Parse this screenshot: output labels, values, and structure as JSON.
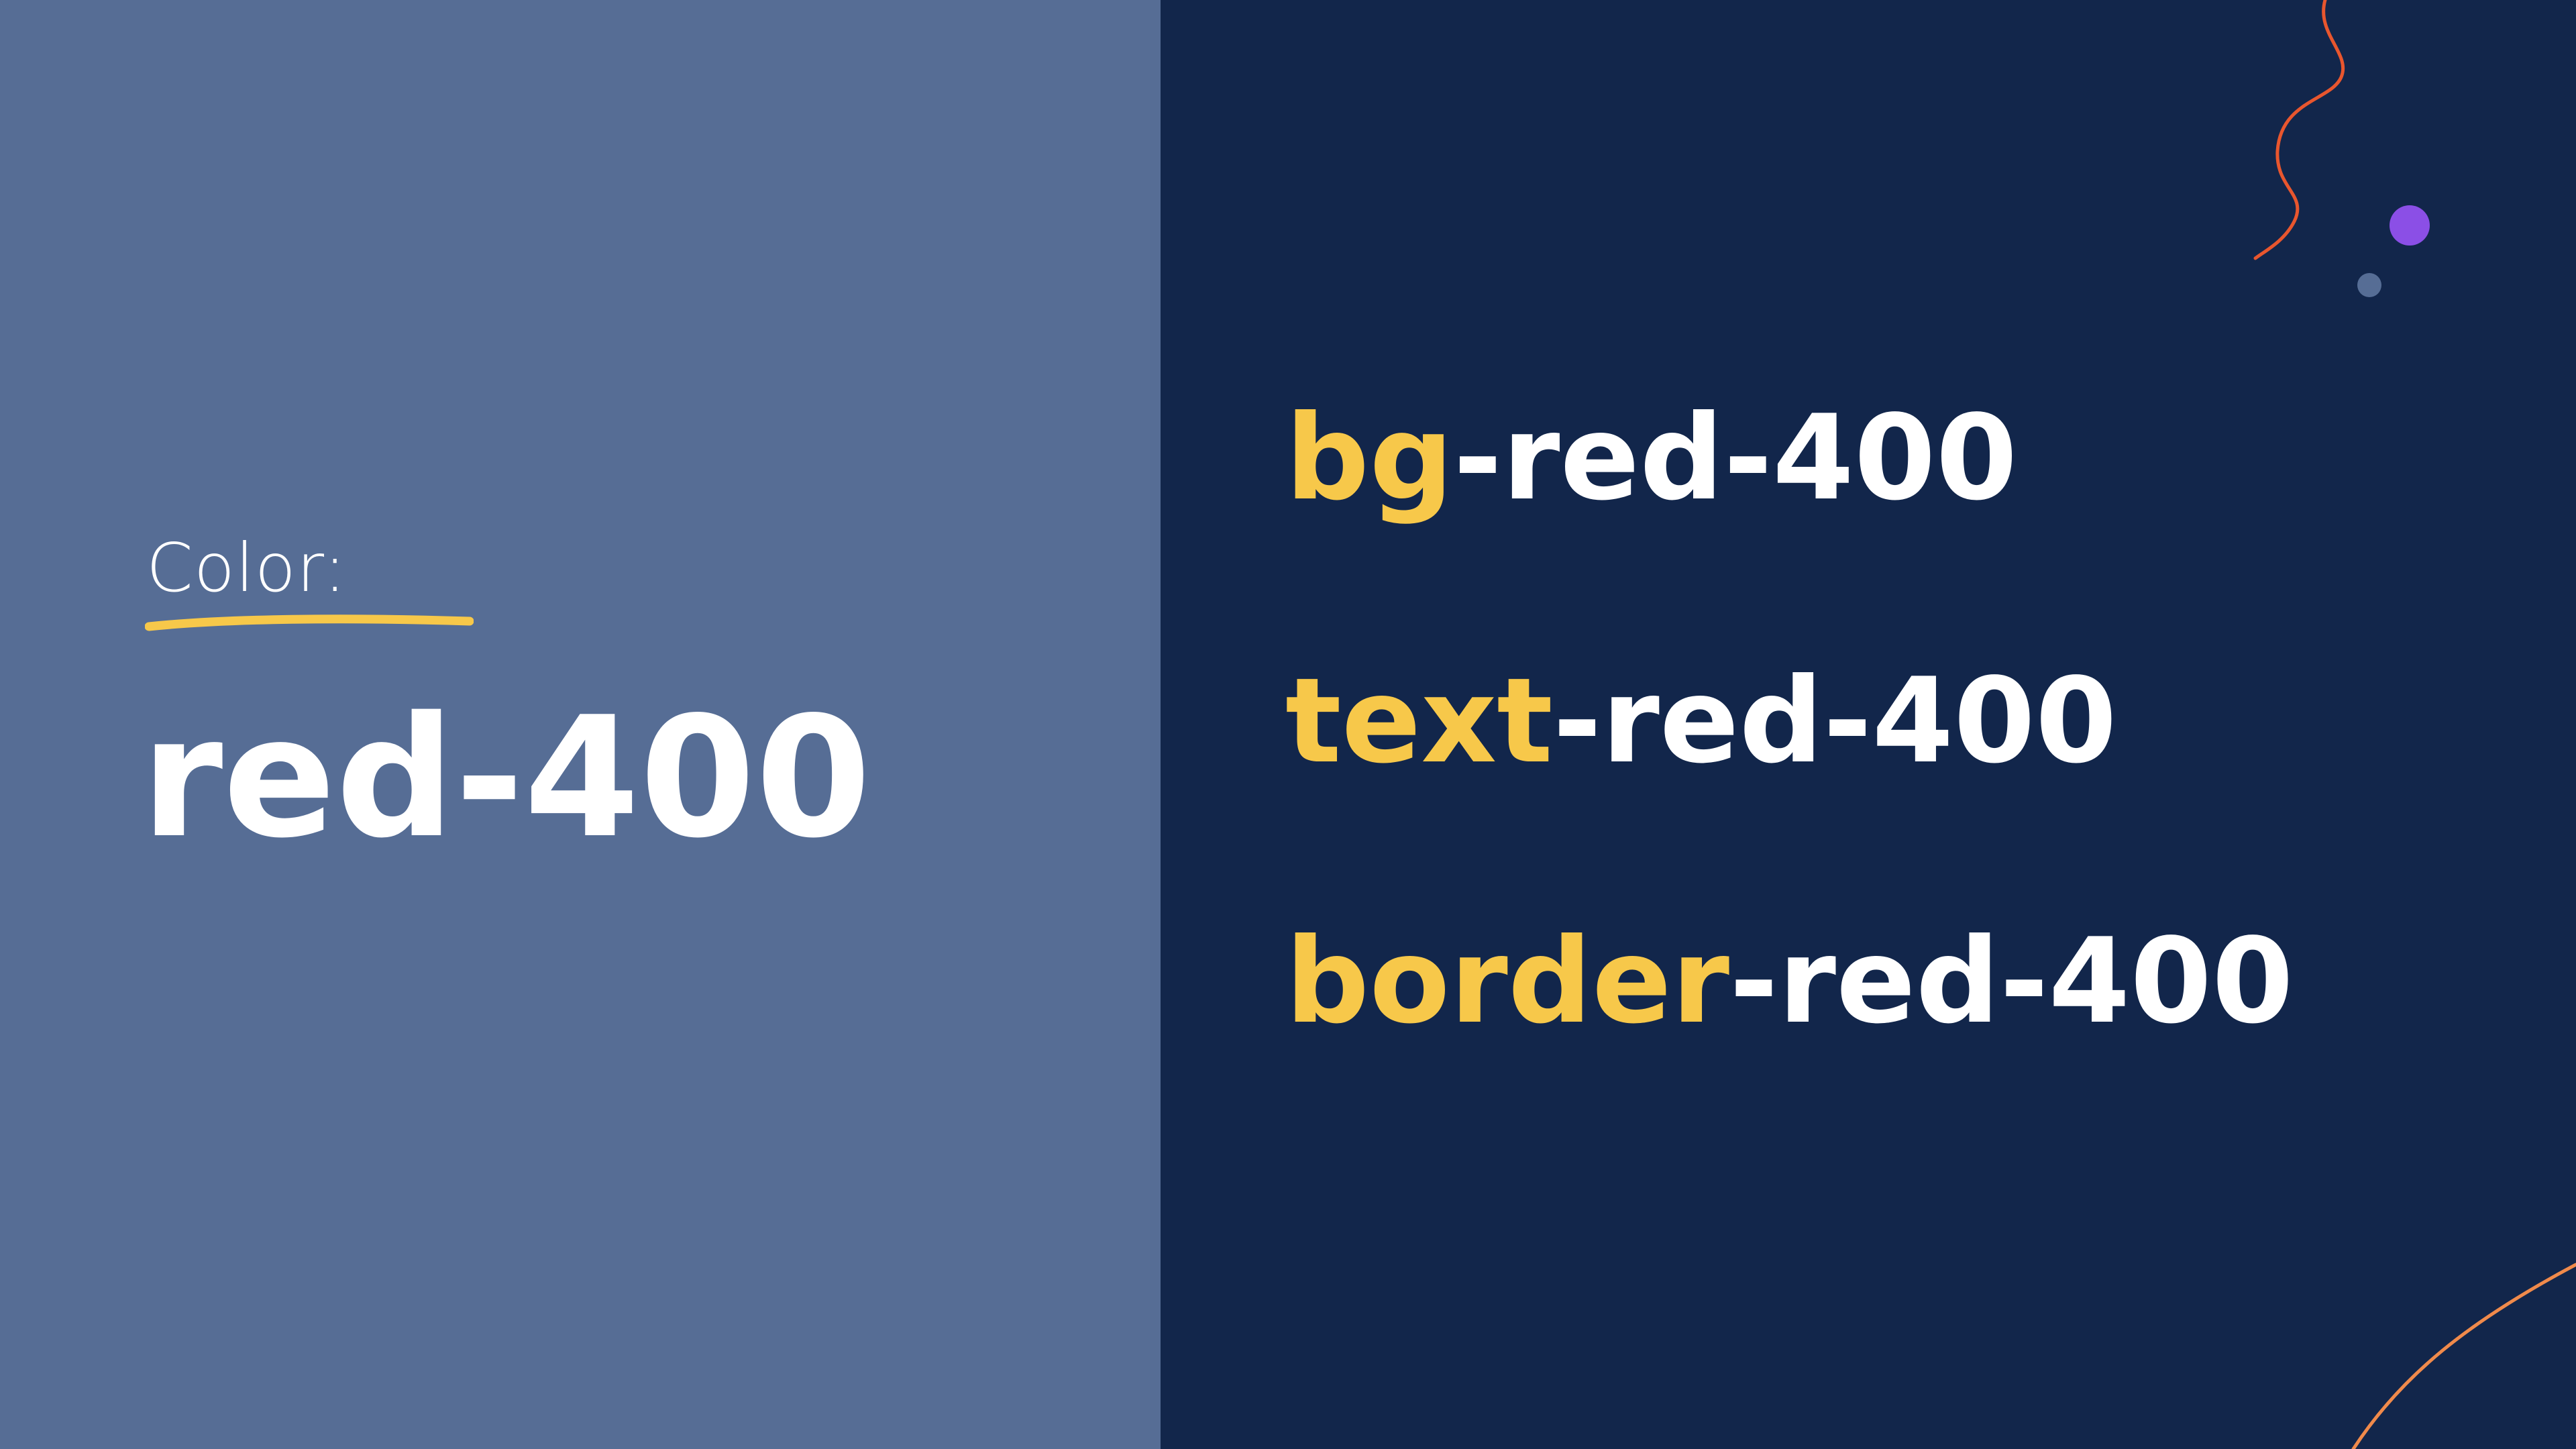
{
  "heading": {
    "label": "Color:",
    "color_name": "red-400"
  },
  "classes": [
    {
      "prefix": "bg",
      "suffix": "-red-400"
    },
    {
      "prefix": "text",
      "suffix": "-red-400"
    },
    {
      "prefix": "border",
      "suffix": "-red-400"
    }
  ],
  "colors": {
    "left_panel": "#566d95",
    "right_panel": "#12264b",
    "accent_yellow": "#f7c84a",
    "squiggle_orange": "#e8562e",
    "curve_orange": "#f08a4b",
    "dot_purple": "#8b4fe6",
    "dot_slate": "#566d95"
  }
}
